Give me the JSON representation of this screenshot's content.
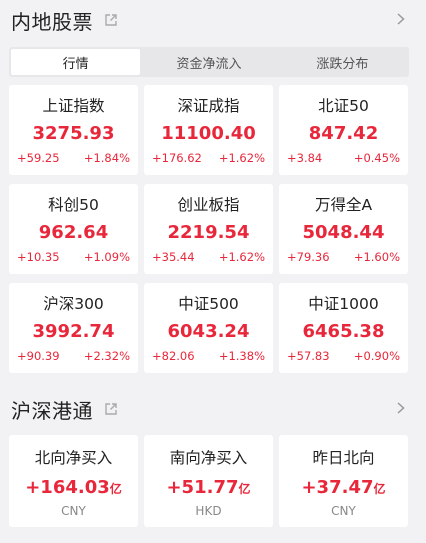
{
  "section1": {
    "title": "内地股票",
    "tabs": [
      {
        "label": "行情",
        "active": true
      },
      {
        "label": "资金净流入",
        "active": false
      },
      {
        "label": "涨跌分布",
        "active": false
      }
    ],
    "cards": [
      {
        "name": "上证指数",
        "value": "3275.93",
        "change": "+59.25",
        "pct": "+1.84%"
      },
      {
        "name": "深证成指",
        "value": "11100.40",
        "change": "+176.62",
        "pct": "+1.62%"
      },
      {
        "name": "北证50",
        "value": "847.42",
        "change": "+3.84",
        "pct": "+0.45%"
      },
      {
        "name": "科创50",
        "value": "962.64",
        "change": "+10.35",
        "pct": "+1.09%"
      },
      {
        "name": "创业板指",
        "value": "2219.54",
        "change": "+35.44",
        "pct": "+1.62%"
      },
      {
        "name": "万得全A",
        "value": "5048.44",
        "change": "+79.36",
        "pct": "+1.60%"
      },
      {
        "name": "沪深300",
        "value": "3992.74",
        "change": "+90.39",
        "pct": "+2.32%"
      },
      {
        "name": "中证500",
        "value": "6043.24",
        "change": "+82.06",
        "pct": "+1.38%"
      },
      {
        "name": "中证1000",
        "value": "6465.38",
        "change": "+57.83",
        "pct": "+0.90%"
      }
    ]
  },
  "section2": {
    "title": "沪深港通",
    "cards": [
      {
        "name": "北向净买入",
        "value": "+164.03",
        "unit": "亿",
        "currency": "CNY"
      },
      {
        "name": "南向净买入",
        "value": "+51.77",
        "unit": "亿",
        "currency": "HKD"
      },
      {
        "name": "昨日北向",
        "value": "+37.47",
        "unit": "亿",
        "currency": "CNY"
      }
    ]
  },
  "colors": {
    "up": "#e8273b",
    "background": "#f2f2f4",
    "card": "#ffffff"
  },
  "icons": {
    "share": "share-external-icon",
    "chevron": "chevron-right-icon"
  }
}
